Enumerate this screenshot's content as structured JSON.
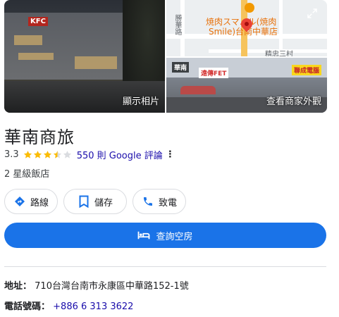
{
  "photos": {
    "main_caption": "顯示相片",
    "store_caption": "查看商家外觀",
    "main_sign": "KFC",
    "store_signs": [
      "遠傳FET",
      "聯成電腦",
      "華南"
    ]
  },
  "map": {
    "poi_label_line1": "焼肉スマ…ル(焼肉",
    "poi_label_line2": "Smile)台南中華店",
    "street_label_left": "勝華路",
    "street_label_bottom": "精忠三村"
  },
  "business": {
    "name": "華南商旅",
    "rating": "3.3",
    "stars": 3.3,
    "reviews_label": "550 則 Google 評論",
    "more_icon": "⋮",
    "category": "2 星級飯店"
  },
  "actions": {
    "directions": "路線",
    "save": "儲存",
    "call": "致電",
    "book": "查詢空房"
  },
  "details": {
    "address_label": "地址：",
    "address_value": "710台灣台南市永康區中華路152-1號",
    "phone_label": "電話號碼：",
    "phone_value": "+886 6 313 3622"
  },
  "colors": {
    "accent": "#1a73e8",
    "star": "#fbbc04",
    "link": "#1a0dab"
  }
}
